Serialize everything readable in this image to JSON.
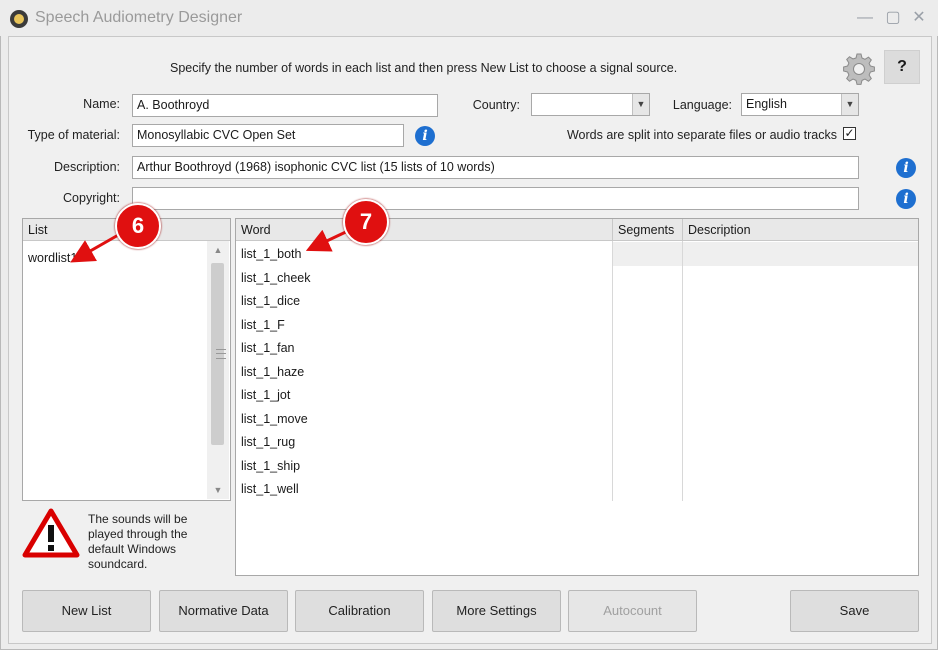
{
  "window": {
    "title": "Speech Audiometry Designer"
  },
  "hint": "Specify the number of words in each list and then press New List to choose a signal source.",
  "help_label": "?",
  "form": {
    "name_label": "Name:",
    "name_value": "A. Boothroyd",
    "country_label": "Country:",
    "country_value": "",
    "language_label": "Language:",
    "language_value": "English",
    "material_label": "Type of material:",
    "material_value": "Monosyllabic CVC Open Set",
    "split_label": "Words are split into separate files or audio tracks",
    "split_checked": true,
    "description_label": "Description:",
    "description_value": "Arthur Boothroyd (1968) isophonic CVC list (15 lists of 10 words)",
    "copyright_label": "Copyright:",
    "copyright_value": ""
  },
  "list_panel": {
    "header": "List",
    "items": [
      "wordlist1"
    ]
  },
  "grid": {
    "headers": {
      "word": "Word",
      "segments": "Segments",
      "description": "Description"
    },
    "words": [
      "list_1_both",
      "list_1_cheek",
      "list_1_dice",
      "list_1_F",
      "list_1_fan",
      "list_1_haze",
      "list_1_jot",
      "list_1_move",
      "list_1_rug",
      "list_1_ship",
      "list_1_well"
    ]
  },
  "warning": "The sounds will be played through the default Windows soundcard.",
  "buttons": {
    "new_list": "New List",
    "normative": "Normative Data",
    "calibration": "Calibration",
    "more_settings": "More Settings",
    "autocount": "Autocount",
    "save": "Save"
  },
  "annotations": {
    "badge_6": "6",
    "badge_7": "7"
  },
  "colors": {
    "accent_info": "#1e6fd0",
    "annotation_red": "#e01010"
  }
}
